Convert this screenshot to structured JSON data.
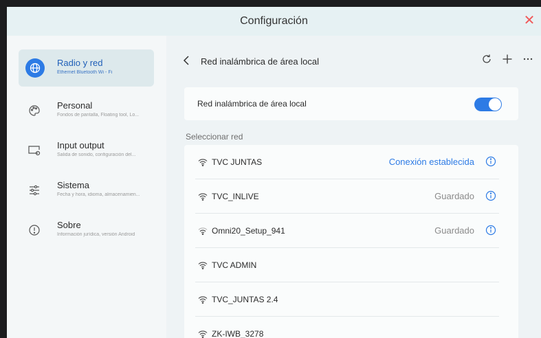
{
  "window": {
    "title": "Configuración"
  },
  "sidebar": {
    "items": [
      {
        "label": "Radio y red",
        "sub": "Ethernet Bluetooth Wi - Fi",
        "icon": "globe-icon",
        "active": true
      },
      {
        "label": "Personal",
        "sub": "Fondos de pantalla, Floating tool, Lo...",
        "icon": "palette-icon"
      },
      {
        "label": "Input output",
        "sub": "Salida de sonido, configuración del...",
        "icon": "display-icon"
      },
      {
        "label": "Sistema",
        "sub": "Fecha y hora, idioma, almacenamien...",
        "icon": "sliders-icon"
      },
      {
        "label": "Sobre",
        "sub": "Información jurídica, versión Android",
        "icon": "info-icon"
      }
    ]
  },
  "main": {
    "header_title": "Red inalámbrica de área local",
    "toggle_label": "Red inalámbrica de área local",
    "toggle_on": true,
    "section_label": "Seleccionar red",
    "networks": [
      {
        "name": "TVC JUNTAS",
        "status": "Conexión establecida"
      },
      {
        "name": "TVC_INLIVE",
        "status": "Guardado"
      },
      {
        "name": "Omni20_Setup_941",
        "status": "Guardado"
      },
      {
        "name": "TVC ADMIN",
        "status": ""
      },
      {
        "name": "TVC_JUNTAS 2.4",
        "status": ""
      },
      {
        "name": "ZK-IWB_3278",
        "status": ""
      }
    ]
  },
  "colors": {
    "accent": "#2d7be5",
    "close": "#f05a5a"
  }
}
